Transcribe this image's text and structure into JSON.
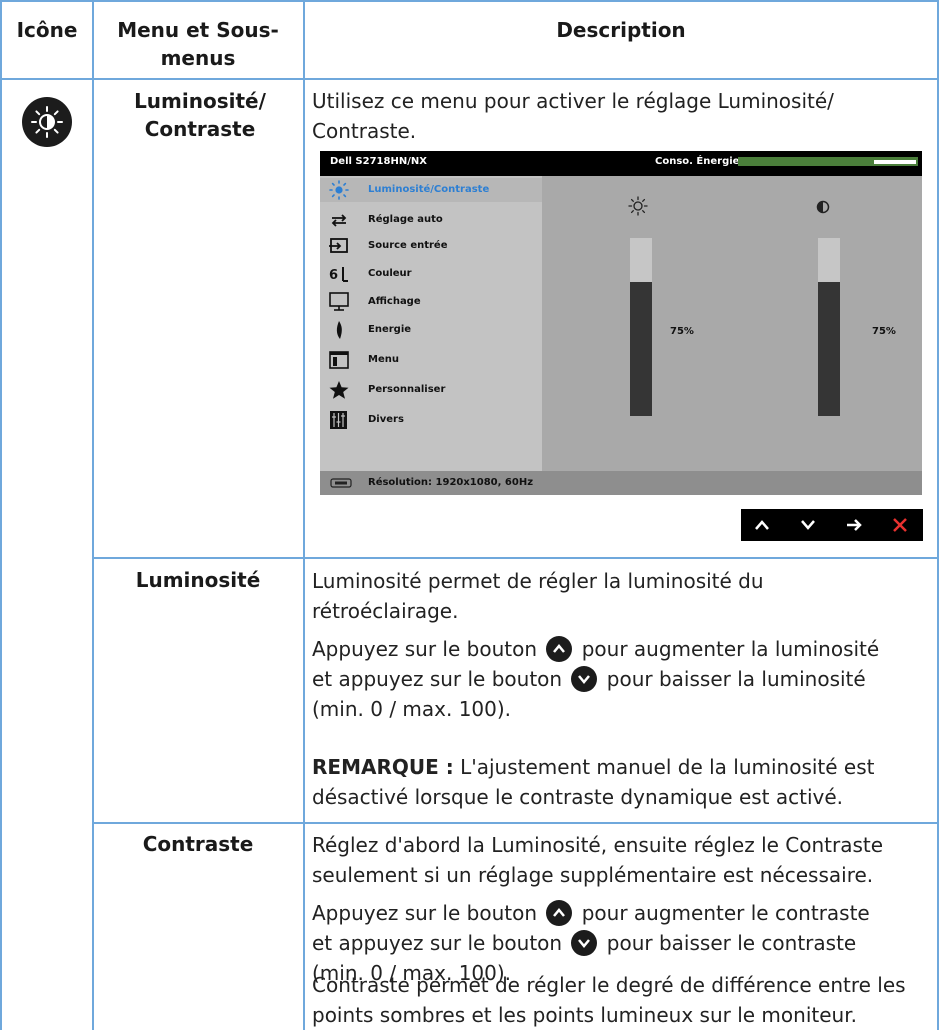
{
  "headers": {
    "icon": "Icône",
    "menu": "Menu et Sous-menus",
    "description": "Description"
  },
  "rows": {
    "brightness_contrast": {
      "icon": "brightness-contrast-icon",
      "menu_name": "Luminosité/ Contraste",
      "description": "Utilisez ce menu pour activer le réglage Luminosité/ Contraste."
    },
    "luminosite": {
      "menu_name": "Luminosité",
      "desc1": "Luminosité permet de régler la luminosité du rétroéclairage.",
      "desc2_a": "Appuyez sur le bouton",
      "desc2_b": "pour augmenter la luminosité",
      "desc2_c": "et appuyez sur le bouton",
      "desc2_d": "pour baisser la luminosité",
      "desc2_e": "(min. 0 / max. 100).",
      "note_label": "REMARQUE :",
      "note_text": "L'ajustement manuel de la luminosité est désactivé lorsque le contraste dynamique est activé."
    },
    "contraste": {
      "menu_name": "Contraste",
      "desc1": "Réglez d'abord la Luminosité, ensuite réglez le Contraste seulement si un réglage supplémentaire est nécessaire.",
      "desc2_a": "Appuyez sur le bouton",
      "desc2_b": "pour augmenter le contraste",
      "desc2_c": "et appuyez sur le bouton",
      "desc2_d": "pour baisser le contraste",
      "desc2_e": "(min. 0 / max. 100).",
      "desc3": "Contraste permet de régler le degré de différence entre les points sombres et les points lumineux sur le moniteur."
    }
  },
  "osd": {
    "model": "Dell S2718HN/NX",
    "energy_label": "Conso. Énergie",
    "energy_level": 0.75,
    "menu_items": [
      {
        "label": "Luminosité/Contraste",
        "icon": "sun-icon",
        "selected": true
      },
      {
        "label": "Réglage auto",
        "icon": "auto-adjust-icon",
        "selected": false
      },
      {
        "label": "Source entrée",
        "icon": "input-source-icon",
        "selected": false
      },
      {
        "label": "Couleur",
        "icon": "color-icon",
        "selected": false
      },
      {
        "label": "Affichage",
        "icon": "display-icon",
        "selected": false
      },
      {
        "label": "Energie",
        "icon": "energy-icon",
        "selected": false
      },
      {
        "label": "Menu",
        "icon": "menu-icon",
        "selected": false
      },
      {
        "label": "Personnaliser",
        "icon": "star-icon",
        "selected": false
      },
      {
        "label": "Divers",
        "icon": "others-icon",
        "selected": false
      }
    ],
    "brightness_value": "75%",
    "contrast_value": "75%",
    "brightness_level": 0.75,
    "contrast_level": 0.75,
    "resolution": "Résolution: 1920x1080, 60Hz",
    "nav_buttons": [
      "up-icon",
      "down-icon",
      "right-arrow-icon",
      "close-icon"
    ]
  },
  "colors": {
    "rule": "#6fa8dc",
    "osd_selected": "#2d7fd3",
    "nav_close": "#e8312f",
    "energy_bar": "#4a7e3a"
  }
}
